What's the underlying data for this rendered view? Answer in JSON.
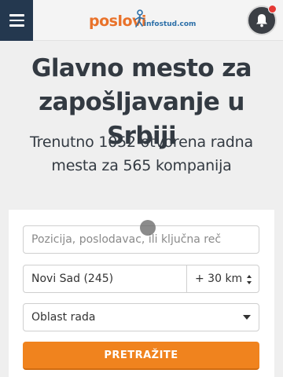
{
  "header": {
    "logo_main": "poslovi",
    "logo_sub": "infostud.com"
  },
  "hero": {
    "title": "Glavno mesto za zapošljavanje u Srbiji",
    "subtitle": "Trenutno 1052 otvorena radna mesta za 565 kompanija"
  },
  "search": {
    "keyword_placeholder": "Pozicija, poslodavac, ili ključna reč",
    "location_value": "Novi Sad (245)",
    "radius_value": "+ 30 km",
    "area_value": "Oblast rada",
    "submit_label": "PRETRAŽITE"
  },
  "colors": {
    "accent": "#f0831e",
    "menu_bg": "#24384f",
    "logo_orange": "#e9722a",
    "logo_blue": "#2c6fa8",
    "notification": "#e53935"
  },
  "icons": {
    "menu": "hamburger-icon",
    "notifications": "bell-icon",
    "logo_figure": "running-person-icon"
  }
}
